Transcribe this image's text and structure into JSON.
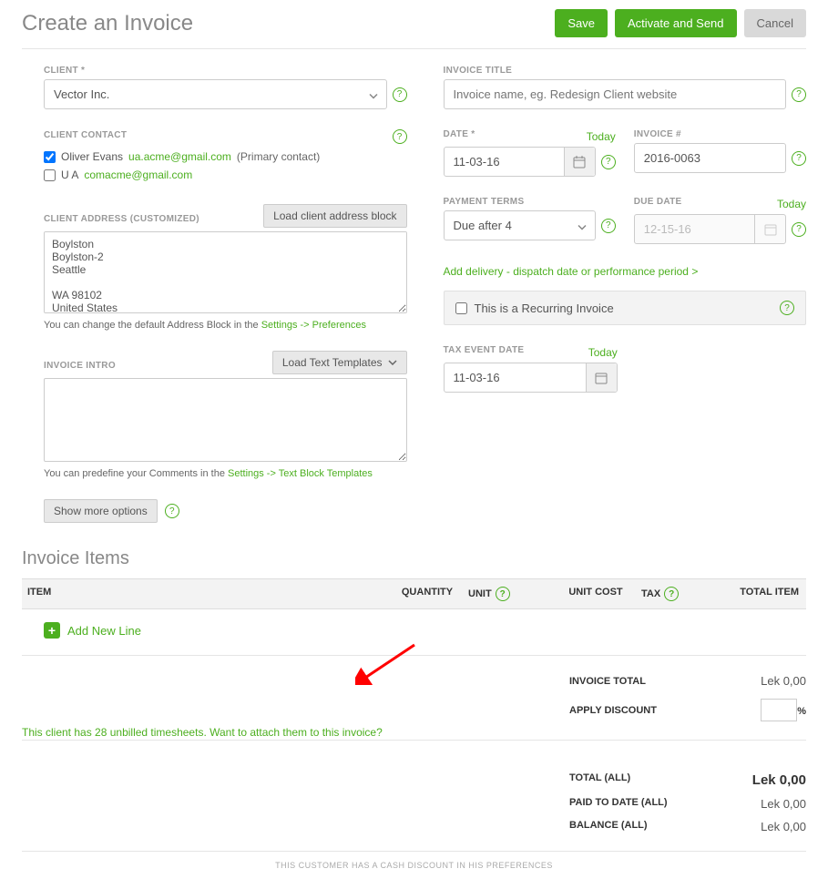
{
  "header": {
    "title": "Create an Invoice",
    "save": "Save",
    "activate_send": "Activate and Send",
    "cancel": "Cancel"
  },
  "client": {
    "label": "CLIENT *",
    "value": "Vector Inc."
  },
  "contact": {
    "label": "CLIENT CONTACT",
    "items": [
      {
        "checked": true,
        "name": "Oliver Evans",
        "email": "ua.acme@gmail.com",
        "suffix": "(Primary contact)"
      },
      {
        "checked": false,
        "name": "U A",
        "email": "comacme@gmail.com",
        "suffix": ""
      }
    ]
  },
  "address": {
    "label": "CLIENT ADDRESS (CUSTOMIZED)",
    "load_btn": "Load client address block",
    "value": "Boylston\nBoylston-2\nSeattle\n\nWA 98102\nUnited States",
    "hint_pre": "You can change the default Address Block in the ",
    "hint_link": "Settings -> Preferences"
  },
  "intro": {
    "label": "INVOICE INTRO",
    "load_btn": "Load Text Templates",
    "hint_pre": "You can predefine your Comments in the ",
    "hint_link": "Settings -> Text Block Templates"
  },
  "more_options": "Show more options",
  "invoice_title": {
    "label": "INVOICE TITLE",
    "placeholder": "Invoice name, eg. Redesign Client website"
  },
  "date": {
    "label": "DATE *",
    "today": "Today",
    "value": "11-03-16"
  },
  "invoice_no": {
    "label": "INVOICE #",
    "value": "2016-0063"
  },
  "terms": {
    "label": "PAYMENT TERMS",
    "value": "Due after 4"
  },
  "due": {
    "label": "DUE DATE",
    "today": "Today",
    "value": "12-15-16"
  },
  "delivery_link": "Add delivery - dispatch date or performance period >",
  "recurring": "This is a Recurring Invoice",
  "tax_event": {
    "label": "TAX EVENT DATE",
    "today": "Today",
    "value": "11-03-16"
  },
  "items": {
    "title": "Invoice Items",
    "headers": {
      "item": "ITEM",
      "qty": "QUANTITY",
      "unit": "UNIT",
      "cost": "UNIT COST",
      "tax": "TAX",
      "total": "TOTAL ITEM"
    },
    "add_line": "Add New Line"
  },
  "totals": {
    "invoice_total_label": "INVOICE TOTAL",
    "invoice_total_value": "Lek 0,00",
    "discount_label": "APPLY DISCOUNT",
    "pct": "%"
  },
  "timesheet_prompt": "This client has 28 unbilled timesheets. Want to attach them to this invoice?",
  "balance": {
    "total_label": "TOTAL (ALL)",
    "total_value": "Lek 0,00",
    "paid_label": "PAID TO DATE (ALL)",
    "paid_value": "Lek 0,00",
    "balance_label": "BALANCE (ALL)",
    "balance_value": "Lek 0,00"
  },
  "footer_note": "THIS CUSTOMER HAS A CASH DISCOUNT IN HIS PREFERENCES"
}
